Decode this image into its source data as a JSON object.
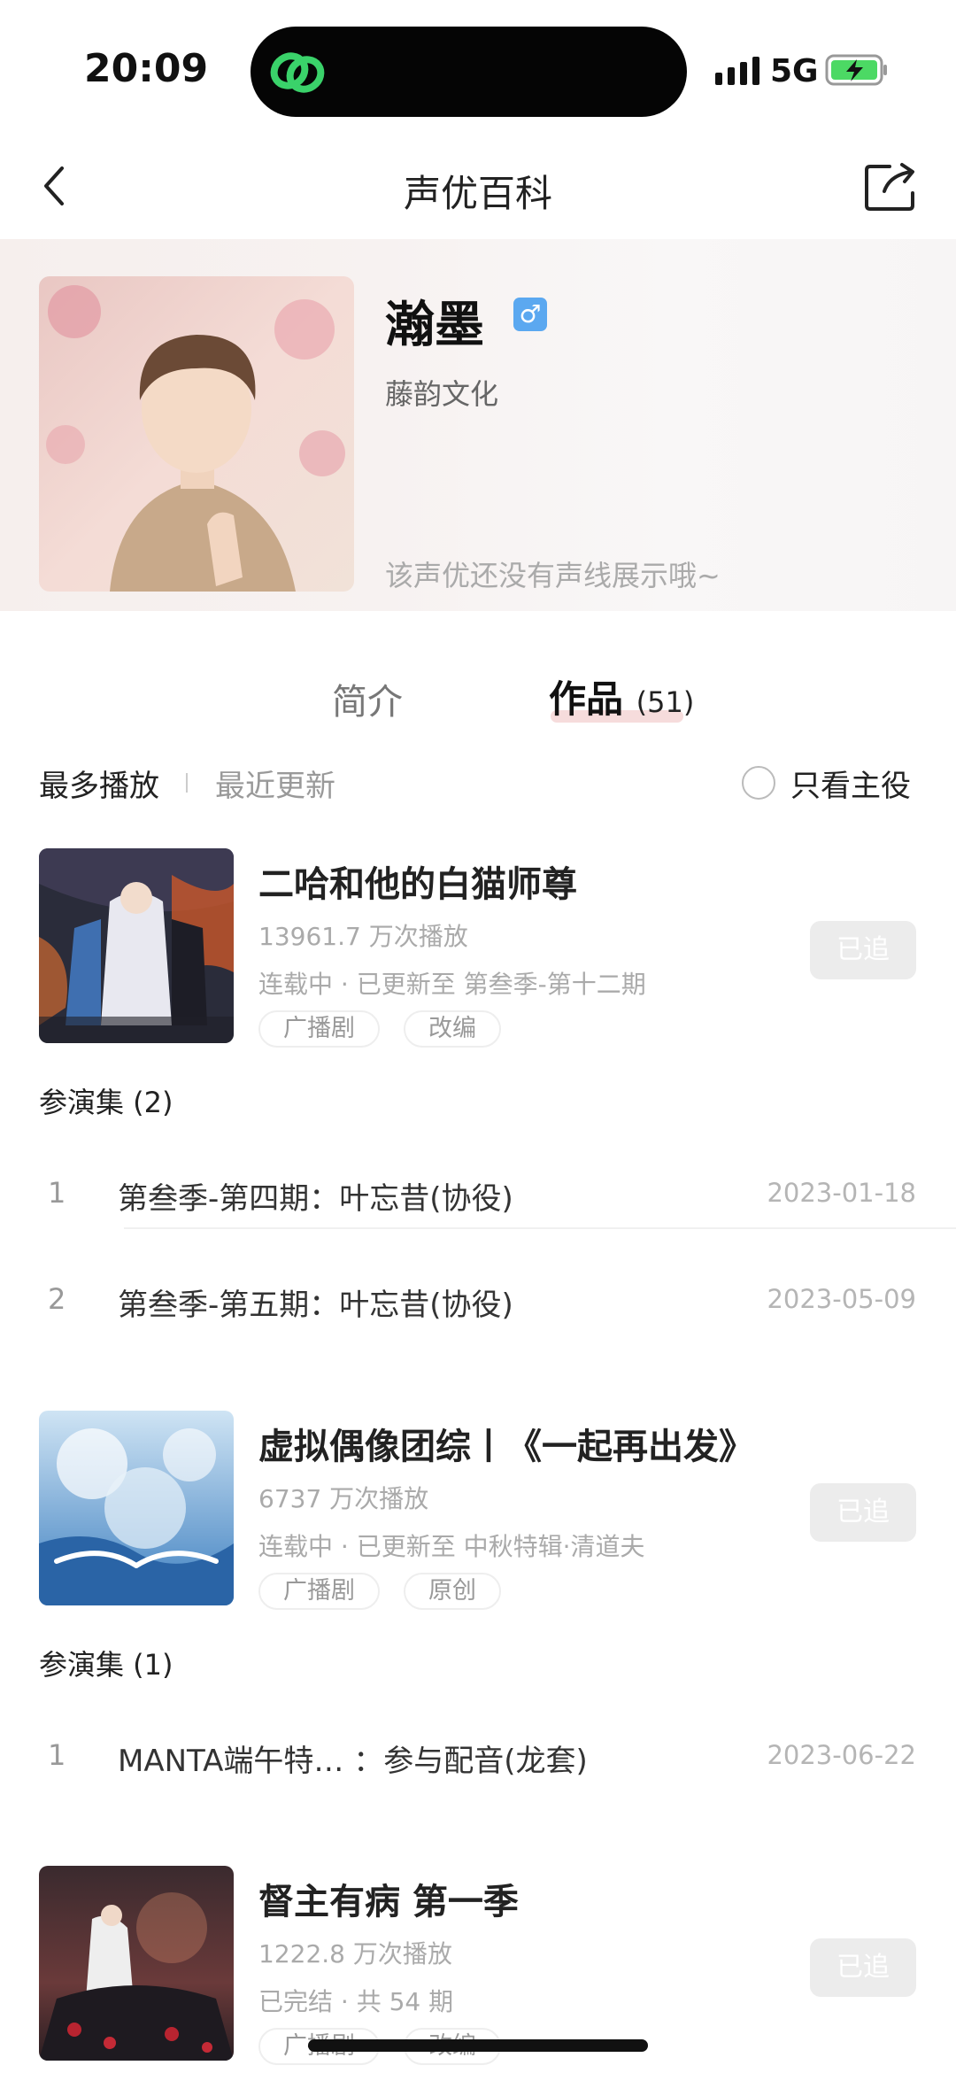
{
  "status": {
    "time": "20:09",
    "network": "5G"
  },
  "nav": {
    "title": "声优百科"
  },
  "profile": {
    "name": "瀚墨",
    "gender": "♂",
    "company": "藤韵文化",
    "no_voice_text": "该声优还没有声线展示哦~"
  },
  "tabs": {
    "intro": "简介",
    "works": "作品",
    "works_count": "(51)"
  },
  "filters": {
    "most_played": "最多播放",
    "recent": "最近更新",
    "only_lead": "只看主役"
  },
  "works": [
    {
      "title": "二哈和他的白猫师尊",
      "plays": "13961.7 万次播放",
      "status": "连载中 · 已更新至 第叁季-第十二期",
      "tags": [
        "广播剧",
        "改编"
      ],
      "follow": "已追",
      "episodes_title": "参演集 (2)",
      "episodes": [
        {
          "num": "1",
          "name": "第叁季-第四期：叶忘昔(协役)",
          "date": "2023-01-18"
        },
        {
          "num": "2",
          "name": "第叁季-第五期：叶忘昔(协役)",
          "date": "2023-05-09"
        }
      ]
    },
    {
      "title": "虚拟偶像团综丨《一起再出发》",
      "plays": "6737 万次播放",
      "status": "连载中 · 已更新至 中秋特辑·清道夫",
      "tags": [
        "广播剧",
        "原创"
      ],
      "follow": "已追",
      "episodes_title": "参演集 (1)",
      "episodes": [
        {
          "num": "1",
          "name": "MANTA端午特…  ：参与配音(龙套)",
          "date": "2023-06-22"
        }
      ]
    },
    {
      "title": "督主有病 第一季",
      "plays": "1222.8 万次播放",
      "status": "已完结 · 共 54 期",
      "tags": [
        "广播剧",
        "改编"
      ],
      "follow": "已追"
    }
  ]
}
